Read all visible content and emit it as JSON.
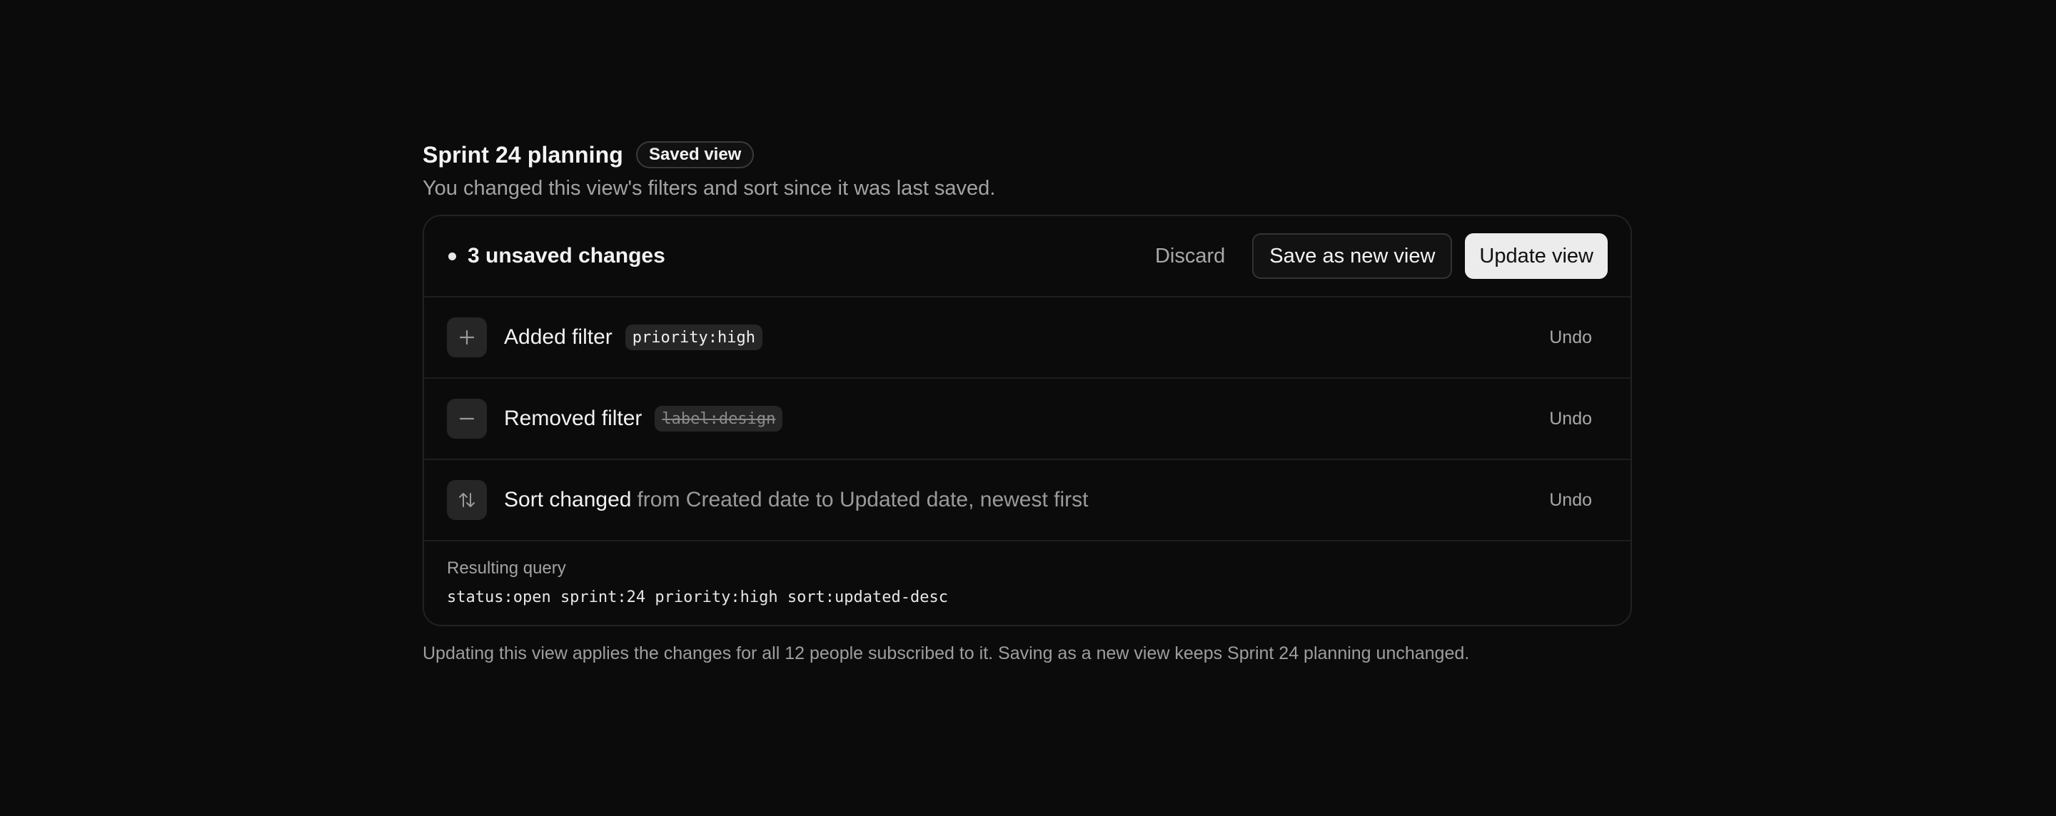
{
  "header": {
    "title": "Sprint 24 planning",
    "badge": "Saved view",
    "subtitle": "You changed this view's filters and sort since it was last saved."
  },
  "toolbar": {
    "unsaved_label": "3 unsaved changes",
    "discard_label": "Discard",
    "save_new_label": "Save as new view",
    "update_label": "Update view"
  },
  "changes": [
    {
      "icon": "plus-icon",
      "label": "Added filter",
      "chip": "priority:high",
      "undo": "Undo"
    },
    {
      "icon": "minus-icon",
      "label": "Removed filter",
      "chip": "label:design",
      "undo": "Undo"
    },
    {
      "icon": "sort-icon",
      "label": "Sort changed",
      "detail": "from Created date to Updated date, newest first",
      "undo": "Undo"
    }
  ],
  "query": {
    "label": "Resulting query",
    "value": "status:open sprint:24 priority:high sort:updated-desc"
  },
  "footnote": "Updating this view applies the changes for all 12 people subscribed to it. Saving as a new view keeps Sprint 24 planning unchanged.",
  "colors": {
    "background": "#0b0b0b",
    "primary_button": "#ececec",
    "muted_text": "#a3a3a3"
  }
}
